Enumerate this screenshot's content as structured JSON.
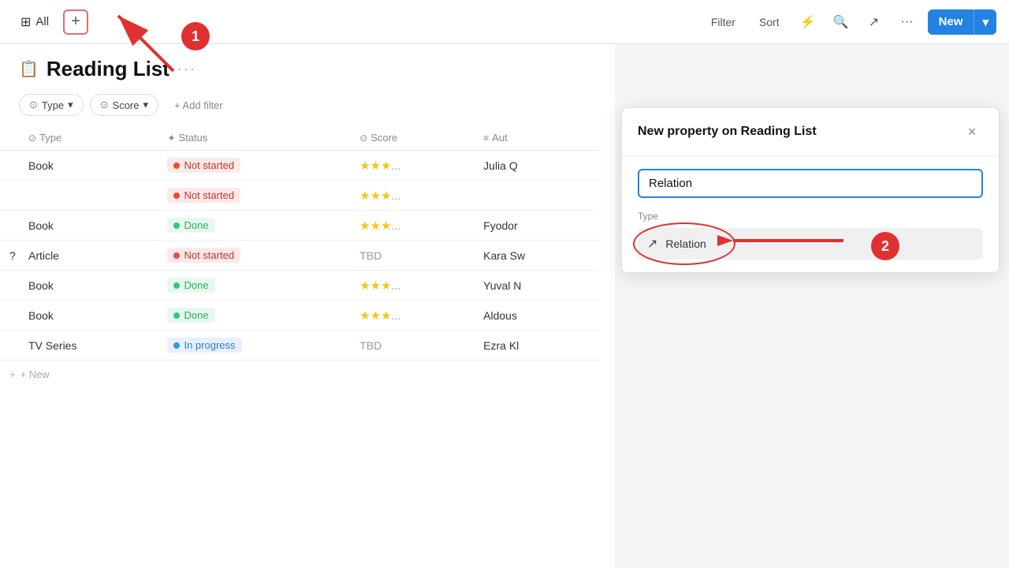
{
  "toolbar": {
    "tab_label": "All",
    "filter_label": "Filter",
    "sort_label": "Sort",
    "new_label": "New",
    "new_arrow": "▾"
  },
  "page": {
    "title": "Reading List",
    "menu_dots": "···"
  },
  "filters": [
    {
      "id": "type",
      "label": "Type",
      "icon": "⊙"
    },
    {
      "id": "score",
      "label": "Score",
      "icon": "⊙"
    }
  ],
  "add_filter_label": "+ Add filter",
  "table": {
    "columns": [
      {
        "id": "type",
        "label": "Type",
        "icon": "⊙"
      },
      {
        "id": "status",
        "label": "Status",
        "icon": "✦"
      },
      {
        "id": "score",
        "label": "Score",
        "icon": "⊙"
      },
      {
        "id": "author",
        "label": "Aut",
        "icon": "≡"
      }
    ],
    "rows": [
      {
        "name": "",
        "type": "Book",
        "status": "Not started",
        "status_class": "not-started",
        "score": "★★★...",
        "author": "Julia Q"
      },
      {
        "name": "",
        "type": "",
        "status": "Not started",
        "status_class": "not-started",
        "score": "",
        "author": ""
      },
      {
        "name": "",
        "type": "Book",
        "status": "Done",
        "status_class": "done",
        "score": "★★★...",
        "author": "Fyodor"
      },
      {
        "name": "?",
        "type": "Article",
        "status": "Not started",
        "status_class": "not-started",
        "score": "TBD",
        "author": "Kara Sw"
      },
      {
        "name": "",
        "type": "Book",
        "status": "Done",
        "status_class": "done",
        "score": "★★★...",
        "author": "Yuval N"
      },
      {
        "name": "",
        "type": "Book",
        "status": "Done",
        "status_class": "done",
        "score": "★★★...",
        "author": "Aldous"
      },
      {
        "name": "",
        "type": "TV Series",
        "status": "In progress",
        "status_class": "in-progress",
        "score": "TBD",
        "author": "Ezra Kl"
      }
    ],
    "add_row_label": "+ New"
  },
  "panel": {
    "title": "New property on Reading List",
    "close_label": "×",
    "input_value": "Relation",
    "input_placeholder": "Relation",
    "type_label": "Type",
    "type_option_label": "Relation",
    "type_option_icon": "↗"
  },
  "annotations": {
    "badge1": "1",
    "badge2": "2"
  }
}
